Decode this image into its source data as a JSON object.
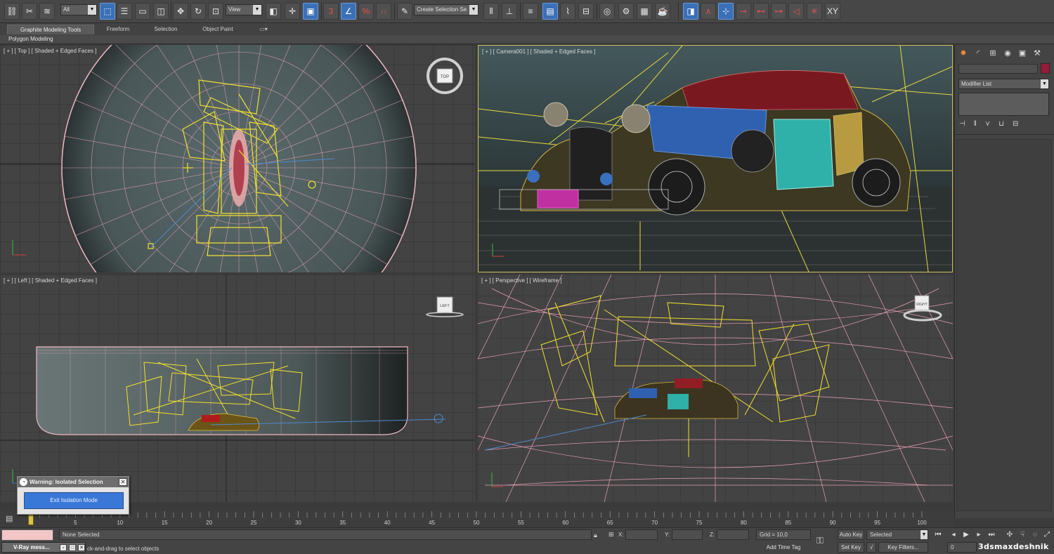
{
  "toolbar": {
    "selection_filter": "All",
    "reference_coord": "View",
    "named_selection": "Create Selection Se",
    "snap_angle_label": "3",
    "percent_snap": "%"
  },
  "ribbon": {
    "tabs": [
      "Graphite Modeling Tools",
      "Freeform",
      "Selection",
      "Object Paint"
    ],
    "active_panel": "Polygon Modeling"
  },
  "viewports": {
    "top": "[ + ] [ Top ] [ Shaded + Edged Faces ]",
    "camera": "[ + ] [ Camera001 ] [ Shaded + Edged Faces ]",
    "left": "[ + ] [ Left ] [ Shaded + Edged Faces ]",
    "perspective": "[ + ] [ Perspective ] [ Wireframe ]",
    "viewcube_top": "TOP",
    "viewcube_left": "LEFT",
    "viewcube_persp": "RIGHT"
  },
  "command_panel": {
    "modifier_list": "Modifier List",
    "object_color": "#9a1a3a"
  },
  "warning_dialog": {
    "title": "Warning: Isolated Selection",
    "button": "Exit Isolation Mode"
  },
  "timeline": {
    "ticks": [
      "0",
      "5",
      "10",
      "15",
      "20",
      "25",
      "30",
      "35",
      "40",
      "45",
      "50",
      "55",
      "60",
      "65",
      "70",
      "75",
      "80",
      "85",
      "90",
      "95",
      "100"
    ]
  },
  "status": {
    "selection": "None Selected",
    "prompt": "ck-and-drag to select objects",
    "vray_tab": "V-Ray mess...",
    "x_label": "X:",
    "y_label": "Y:",
    "z_label": "Z:",
    "grid": "Grid = 10,0",
    "add_time_tag": "Add Time Tag",
    "auto_key": "Auto Key",
    "set_key": "Set Key",
    "key_mode": "Selected",
    "key_filters": "Key Filters...",
    "frame": "0",
    "watermark": "3dsmaxdeshnik"
  }
}
